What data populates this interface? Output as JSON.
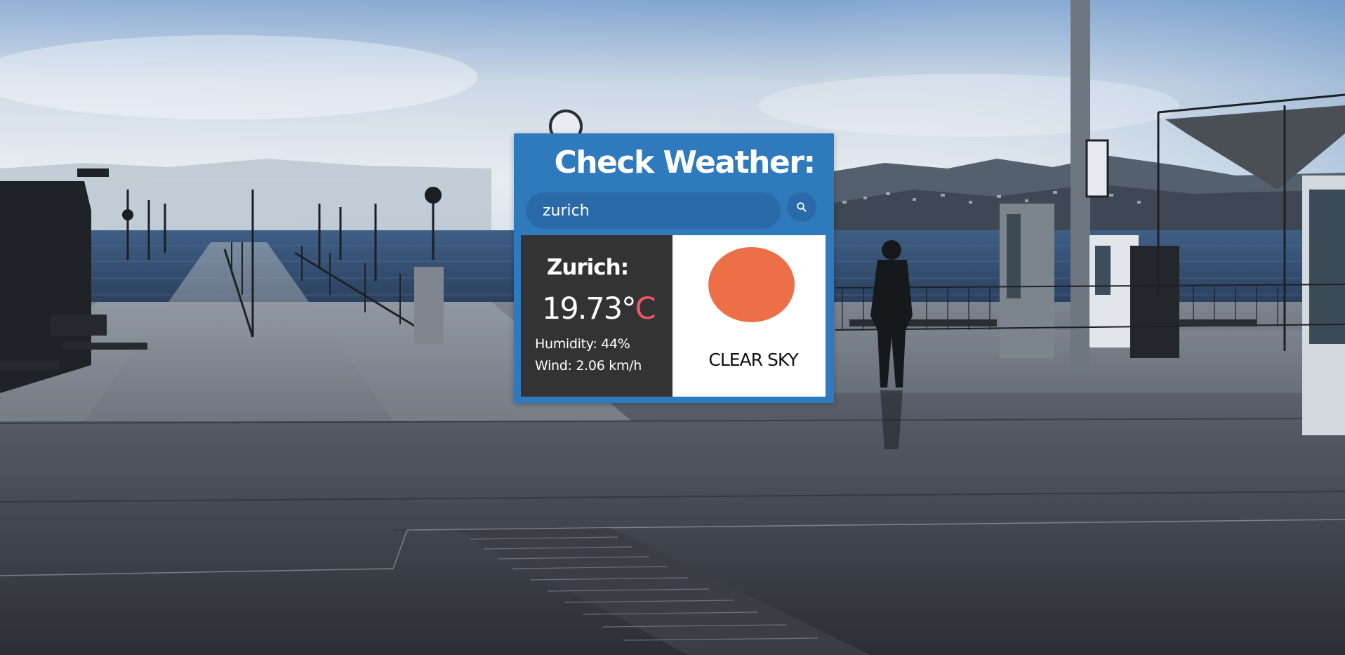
{
  "app": {
    "title": "Check Weather:"
  },
  "search": {
    "value": "zurich",
    "button_icon": "search-icon"
  },
  "weather": {
    "city": "Zurich:",
    "temperature_value": "19.73°",
    "temperature_unit": "C",
    "humidity": "Humidity: 44%",
    "wind": "Wind: 2.06 km/h",
    "condition": "CLEAR SKY",
    "condition_icon": "sun-icon"
  },
  "colors": {
    "card_background": "#2f79bd",
    "input_background": "#2a6aa8",
    "info_panel_background": "#333333",
    "unit_accent": "#f0566a",
    "sun": "#ec6f48"
  }
}
